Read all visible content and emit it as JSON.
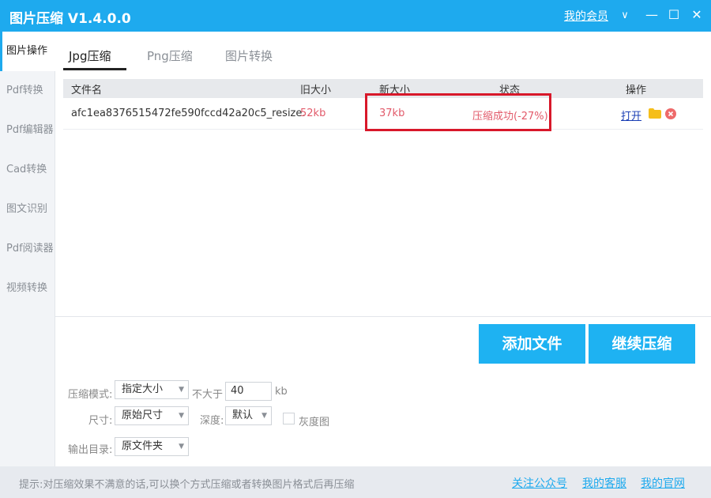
{
  "window": {
    "title": "图片压缩 V1.4.0.0",
    "member_label": "我的会员",
    "member_chevron": "∨",
    "minimize": "—",
    "maximize": "☐",
    "close": "✕"
  },
  "sidebar": {
    "items": [
      "图片操作",
      "Pdf转换",
      "Pdf编辑器",
      "Cad转换",
      "图文识别",
      "Pdf阅读器",
      "视频转换"
    ],
    "active_index": 0
  },
  "tabs": {
    "items": [
      "Jpg压缩",
      "Png压缩",
      "图片转换"
    ],
    "active_index": 0
  },
  "table": {
    "headers": [
      "文件名",
      "旧大小",
      "新大小",
      "状态",
      "操作"
    ],
    "rows": [
      {
        "filename": "afc1ea8376515472fe590fccd42a20c5_resize.",
        "old_size": "52kb",
        "new_size": "37kb",
        "status": "压缩成功(-27%)",
        "action_open": "打开"
      }
    ]
  },
  "buttons": {
    "add_files": "添加文件",
    "continue_compress": "继续压缩"
  },
  "settings": {
    "mode_label": "压缩模式:",
    "mode_value": "指定大小",
    "not_exceed_label": "不大于",
    "size_value": "40",
    "size_unit": "kb",
    "dimension_label": "尺寸:",
    "dimension_value": "原始尺寸",
    "depth_label": "深度:",
    "depth_value": "默认",
    "grayscale_label": "灰度图",
    "output_label": "输出目录:",
    "output_value": "原文件夹"
  },
  "footer": {
    "tip": "提示:对压缩效果不满意的话,可以换个方式压缩或者转换图片格式后再压缩",
    "links": [
      "关注公众号",
      "我的客服",
      "我的官网"
    ]
  },
  "colors": {
    "accent": "#1eaaee",
    "status_red": "#e25a6a",
    "highlight_red": "#d8182a"
  }
}
